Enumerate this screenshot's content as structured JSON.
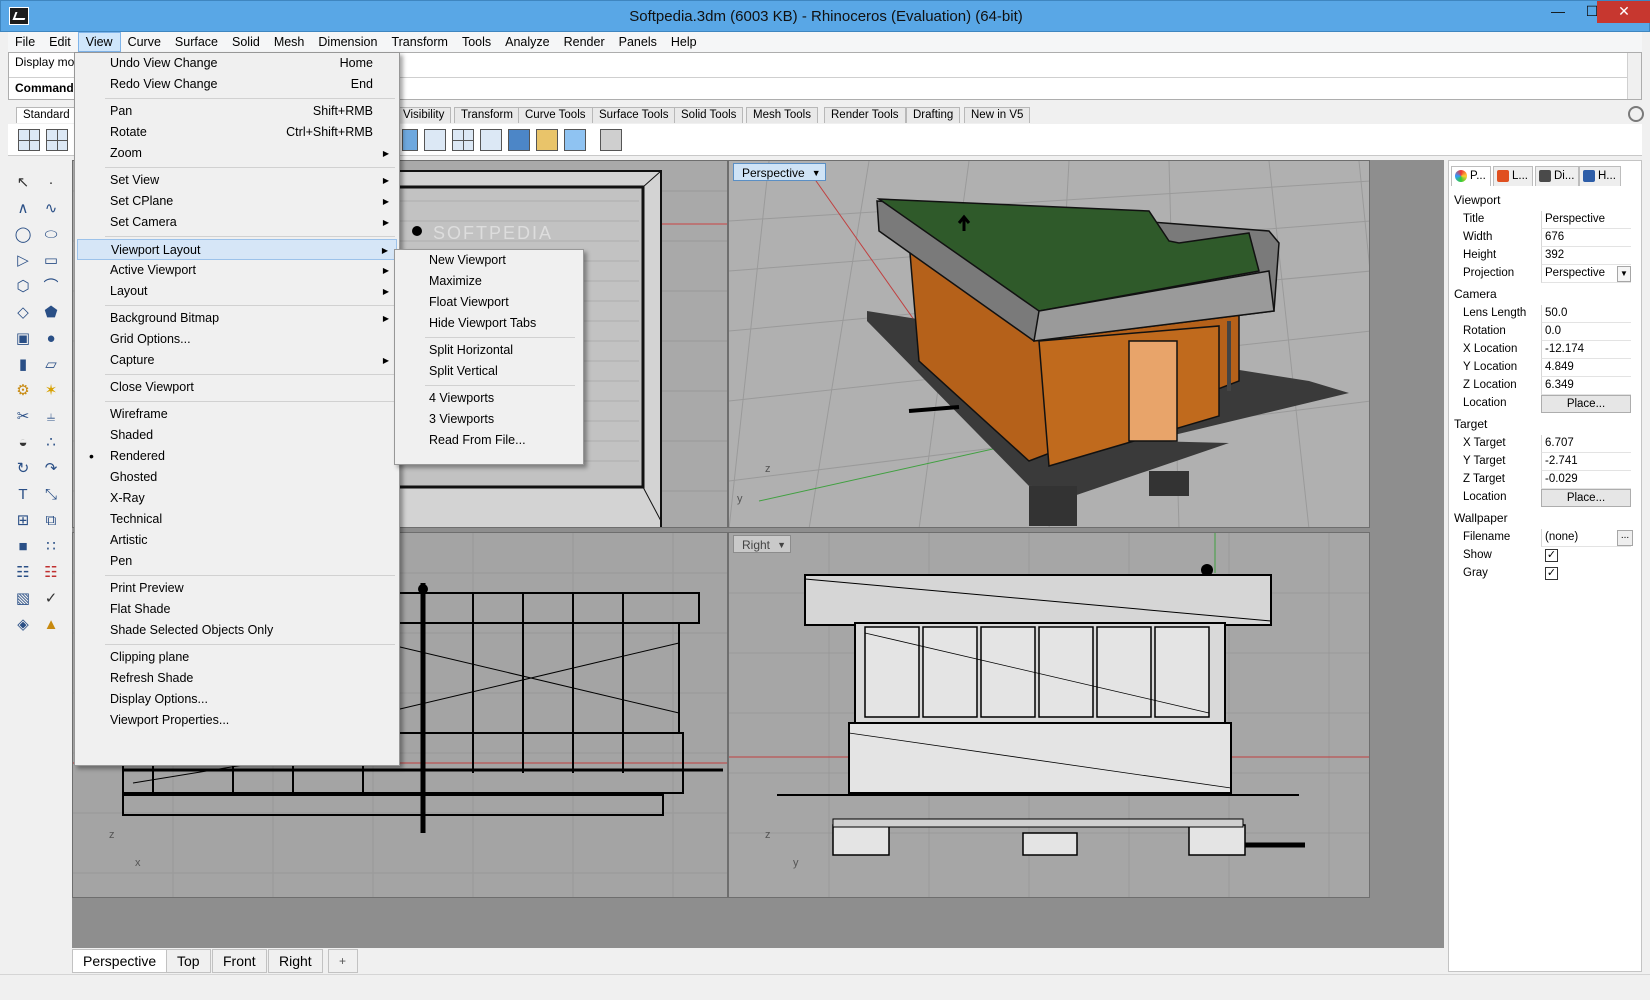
{
  "window": {
    "title": "Softpedia.3dm (6003 KB) - Rhinoceros (Evaluation) (64-bit)",
    "minimize_glyph": "—",
    "maximize_glyph": "☐",
    "close_glyph": "✕"
  },
  "menubar": [
    "File",
    "Edit",
    "View",
    "Curve",
    "Surface",
    "Solid",
    "Mesh",
    "Dimension",
    "Transform",
    "Tools",
    "Analyze",
    "Render",
    "Panels",
    "Help"
  ],
  "command": {
    "history": "Display mo",
    "prompt": "Command"
  },
  "toolbar_tabs": [
    "Standard",
    "Visibility",
    "Transform",
    "Curve Tools",
    "Surface Tools",
    "Solid Tools",
    "Mesh Tools",
    "Render Tools",
    "Drafting",
    "New in V5"
  ],
  "view_menu": {
    "items": [
      {
        "label": "Undo View Change",
        "shortcut": "Home"
      },
      {
        "label": "Redo View Change",
        "shortcut": "End"
      },
      {
        "label": "Pan",
        "shortcut": "Shift+RMB"
      },
      {
        "label": "Rotate",
        "shortcut": "Ctrl+Shift+RMB"
      },
      {
        "label": "Zoom",
        "submenu": true
      },
      {
        "label": "Set View",
        "submenu": true
      },
      {
        "label": "Set CPlane",
        "submenu": true
      },
      {
        "label": "Set Camera",
        "submenu": true
      },
      {
        "label": "Viewport Layout",
        "submenu": true
      },
      {
        "label": "Active Viewport",
        "submenu": true
      },
      {
        "label": "Layout",
        "submenu": true
      },
      {
        "label": "Background Bitmap",
        "submenu": true
      },
      {
        "label": "Grid Options..."
      },
      {
        "label": "Capture",
        "submenu": true
      },
      {
        "label": "Close Viewport"
      },
      {
        "label": "Wireframe"
      },
      {
        "label": "Shaded"
      },
      {
        "label": "Rendered"
      },
      {
        "label": "Ghosted"
      },
      {
        "label": "X-Ray"
      },
      {
        "label": "Technical"
      },
      {
        "label": "Artistic"
      },
      {
        "label": "Pen"
      },
      {
        "label": "Print Preview"
      },
      {
        "label": "Flat Shade"
      },
      {
        "label": "Shade Selected Objects Only"
      },
      {
        "label": "Clipping plane"
      },
      {
        "label": "Refresh Shade"
      },
      {
        "label": "Display Options..."
      },
      {
        "label": "Viewport Properties..."
      }
    ],
    "submenu_arrow": "▶",
    "bullet": "•"
  },
  "viewport_layout_submenu": [
    "New Viewport",
    "Maximize",
    "Float Viewport",
    "Hide Viewport Tabs",
    "Split Horizontal",
    "Split Vertical",
    "4 Viewports",
    "3 Viewports",
    "Read From File..."
  ],
  "viewports": {
    "perspective_label": "Perspective",
    "right_label": "Right",
    "dropdown_arrow": "▼",
    "watermark": "SOFTPEDIA",
    "axis": {
      "x": "x",
      "y": "y",
      "z": "z"
    }
  },
  "viewport_tabs": [
    "Perspective",
    "Top",
    "Front",
    "Right"
  ],
  "viewport_tab_add": "+",
  "panel": {
    "tabs": [
      "P...",
      "L...",
      "Di...",
      "H..."
    ],
    "viewport_section": "Viewport",
    "title_label": "Title",
    "title_value": "Perspective",
    "width_label": "Width",
    "width_value": "676",
    "height_label": "Height",
    "height_value": "392",
    "projection_label": "Projection",
    "projection_value": "Perspective",
    "camera_section": "Camera",
    "lens_label": "Lens Length",
    "lens_value": "50.0",
    "rotation_label": "Rotation",
    "rotation_value": "0.0",
    "xloc_label": "X Location",
    "xloc_value": "-12.174",
    "yloc_label": "Y Location",
    "yloc_value": "4.849",
    "zloc_label": "Z Location",
    "zloc_value": "6.349",
    "location_label": "Location",
    "place_button": "Place...",
    "target_section": "Target",
    "xtgt_label": "X Target",
    "xtgt_value": "6.707",
    "ytgt_label": "Y Target",
    "ytgt_value": "-2.741",
    "ztgt_label": "Z Target",
    "ztgt_value": "-0.029",
    "target_location_label": "Location",
    "target_place_button": "Place...",
    "wallpaper_section": "Wallpaper",
    "filename_label": "Filename",
    "filename_value": "(none)",
    "browse_button": "...",
    "show_label": "Show",
    "show_checked": "✓",
    "gray_label": "Gray",
    "gray_checked": "✓"
  },
  "colors": {
    "titlebar": "#59a7e6",
    "roof": "#2f5a2a",
    "wall": "#b5611a",
    "door": "#e8a46a",
    "grid_bg": "#a6a6a6"
  }
}
